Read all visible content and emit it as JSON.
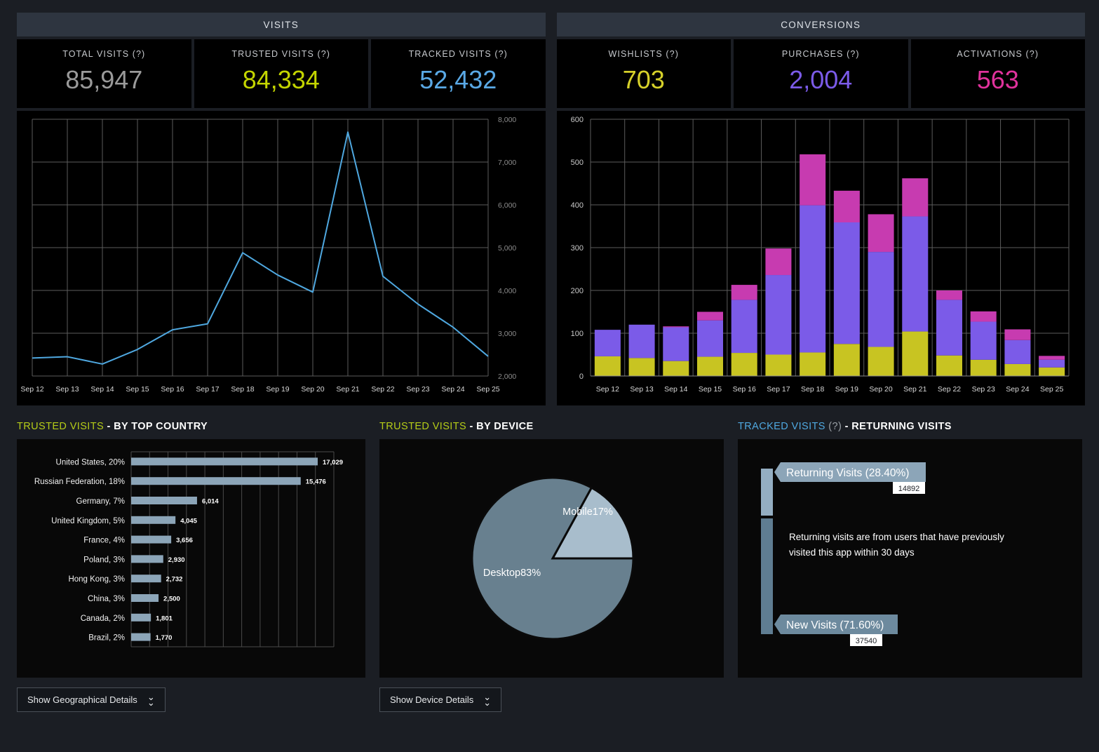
{
  "visits_panel": {
    "title": "VISITS",
    "kpis": [
      {
        "label": "TOTAL VISITS (?)",
        "value": "85,947",
        "color": "#9a9a9a"
      },
      {
        "label": "TRUSTED VISITS (?)",
        "value": "84,334",
        "color": "#c4d500"
      },
      {
        "label": "TRACKED VISITS (?)",
        "value": "52,432",
        "color": "#5aa9e6"
      }
    ]
  },
  "conversions_panel": {
    "title": "CONVERSIONS",
    "kpis": [
      {
        "label": "WISHLISTS (?)",
        "value": "703",
        "color": "#d6d12a"
      },
      {
        "label": "PURCHASES (?)",
        "value": "2,004",
        "color": "#7b5be8"
      },
      {
        "label": "ACTIVATIONS (?)",
        "value": "563",
        "color": "#e0329c"
      }
    ]
  },
  "bottom_sections": {
    "country": {
      "accent": "TRUSTED VISITS",
      "rest": " - BY TOP COUNTRY",
      "accent_color": "#b5cc18"
    },
    "device": {
      "accent": "TRUSTED VISITS",
      "rest": " - BY DEVICE",
      "accent_color": "#b5cc18"
    },
    "returning": {
      "accent": "TRACKED VISITS",
      "q": " (?)",
      "rest": " - RETURNING VISITS",
      "accent_color": "#4fa8e0"
    }
  },
  "buttons": {
    "geo": "Show Geographical Details",
    "device": "Show Device Details"
  },
  "returning_panel": {
    "returning_label": "Returning Visits (28.40%)",
    "returning_value": "14892",
    "new_label": "New Visits (71.60%)",
    "new_value": "37540",
    "description": "Returning visits are from users that have previously visited this app within 30 days",
    "returning_pct": 28.4,
    "new_pct": 71.6,
    "returning_color": "#94aec2",
    "new_color": "#5f7d92"
  },
  "chart_data": [
    {
      "type": "line",
      "id": "visits-over-time",
      "title": "",
      "xlabel": "",
      "ylabel": "",
      "grid": true,
      "legend": "none",
      "axis_position": "right",
      "line_color": "#4fa8e0",
      "x": [
        "Sep 12",
        "Sep 13",
        "Sep 14",
        "Sep 15",
        "Sep 16",
        "Sep 17",
        "Sep 18",
        "Sep 19",
        "Sep 20",
        "Sep 21",
        "Sep 22",
        "Sep 23",
        "Sep 24",
        "Sep 25"
      ],
      "values": [
        2420,
        2450,
        2280,
        2620,
        3080,
        3220,
        4880,
        4360,
        3960,
        7700,
        4330,
        3680,
        3140,
        2460
      ],
      "ylim": [
        2000,
        8000
      ],
      "yticks": [
        2000,
        3000,
        4000,
        5000,
        6000,
        7000,
        8000
      ],
      "ytick_labels": [
        "2,000",
        "3,000",
        "4,000",
        "5,000",
        "6,000",
        "7,000",
        "8,000"
      ]
    },
    {
      "type": "bar",
      "id": "conversions-over-time",
      "stacked": true,
      "title": "",
      "xlabel": "",
      "ylabel": "",
      "grid": true,
      "legend": "none",
      "axis_position": "left",
      "categories": [
        "Sep 12",
        "Sep 13",
        "Sep 14",
        "Sep 15",
        "Sep 16",
        "Sep 17",
        "Sep 18",
        "Sep 19",
        "Sep 20",
        "Sep 21",
        "Sep 22",
        "Sep 23",
        "Sep 24",
        "Sep 25"
      ],
      "series": [
        {
          "name": "Wishlists",
          "color": "#c8c422",
          "values": [
            46,
            42,
            35,
            45,
            54,
            50,
            55,
            75,
            68,
            104,
            48,
            38,
            28,
            20
          ]
        },
        {
          "name": "Purchases",
          "color": "#7b5be8",
          "values": [
            62,
            78,
            79,
            85,
            124,
            186,
            344,
            284,
            222,
            269,
            130,
            89,
            56,
            18
          ]
        },
        {
          "name": "Activations",
          "color": "#c73bb0",
          "values": [
            0,
            0,
            2,
            20,
            35,
            62,
            119,
            74,
            88,
            89,
            22,
            24,
            25,
            9
          ]
        }
      ],
      "ylim": [
        0,
        600
      ],
      "yticks": [
        0,
        100,
        200,
        300,
        400,
        500,
        600
      ],
      "ytick_labels": [
        "0",
        "100",
        "200",
        "300",
        "400",
        "500",
        "600"
      ]
    },
    {
      "type": "bar",
      "id": "trusted-visits-by-country",
      "orientation": "horizontal",
      "title": "",
      "grid": true,
      "legend": "none",
      "bar_color": "#8ca5b8",
      "categories": [
        "United States, 20%",
        "Russian Federation, 18%",
        "Germany, 7%",
        "United Kingdom, 5%",
        "France, 4%",
        "Poland, 3%",
        "Hong Kong, 3%",
        "China, 3%",
        "Canada, 2%",
        "Brazil, 2%"
      ],
      "values": [
        17029,
        15476,
        6014,
        4045,
        3656,
        2930,
        2732,
        2500,
        1801,
        1770
      ],
      "value_labels": [
        "17,029",
        "15,476",
        "6,014",
        "4,045",
        "3,656",
        "2,930",
        "2,732",
        "2,500",
        "1,801",
        "1,770"
      ],
      "xlim": [
        0,
        18500
      ]
    },
    {
      "type": "pie",
      "id": "trusted-visits-by-device",
      "title": "",
      "legend": "none",
      "slices": [
        {
          "label": "Desktop83%",
          "value": 83,
          "color": "#68808f"
        },
        {
          "label": "Mobile17%",
          "value": 17,
          "color": "#a8bdcc"
        }
      ]
    }
  ]
}
